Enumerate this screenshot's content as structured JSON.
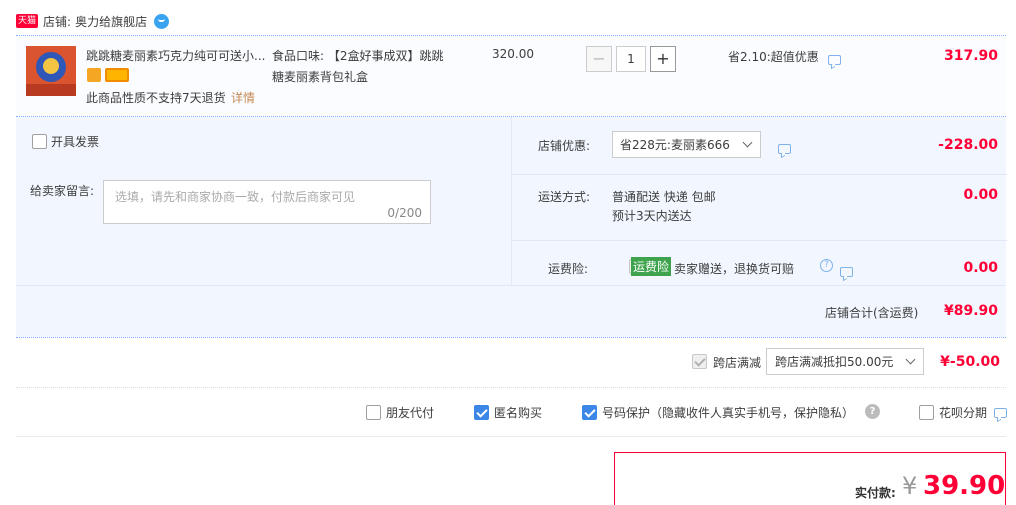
{
  "shop": {
    "badge": "天猫",
    "label": "店铺:",
    "name": "奥力给旗舰店"
  },
  "item": {
    "title": "跳跳糖麦丽素巧克力纯可可送小...",
    "attr_line1": "食品口味: 【2盒好事成双】跳跳",
    "attr_line2": "糖麦丽素背包礼盒",
    "unit_price": "320.00",
    "quantity": "1",
    "qty_minus": "−",
    "qty_plus": "+",
    "promo": "省2.10:超值优惠",
    "subtotal": "317.90",
    "no_return": "此商品性质不支持7天退货",
    "detail_link": "详情"
  },
  "invoice": {
    "label": "开具发票"
  },
  "message": {
    "label": "给卖家留言:",
    "placeholder": "选填，请先和商家协商一致，付款后商家可见",
    "counter": "0/200"
  },
  "shop_discount": {
    "label": "店铺优惠:",
    "selected": "省228元:麦丽素666",
    "amount": "-228.00"
  },
  "shipping": {
    "label": "运送方式:",
    "method": "普通配送 快递 包邮",
    "eta": "预计3天内送达",
    "amount": "0.00"
  },
  "insurance": {
    "label": "运费险:",
    "badge": "运费险",
    "desc": "卖家赠送，退换货可赔",
    "amount": "0.00"
  },
  "shop_total": {
    "label": "店铺合计(含运费)",
    "amount": "¥89.90"
  },
  "cross_store": {
    "label": "跨店满减",
    "selected": "跨店满减抵扣50.00元",
    "amount": "¥-50.00"
  },
  "options": {
    "friend_pay": "朋友代付",
    "anonymous": "匿名购买",
    "number_protect": "号码保护（隐藏收件人真实手机号，保护隐私）",
    "huabei": "花呗分期"
  },
  "pay": {
    "label": "实付款:",
    "currency": "¥",
    "amount": "39.90"
  },
  "colors": {
    "accent_red": "#ff0036",
    "panel_blue": "#f2f7ff",
    "check_blue": "#3c86e8",
    "insurance_green": "#3fa34d"
  }
}
